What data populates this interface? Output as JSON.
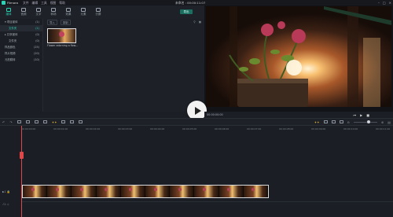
{
  "titlebar": {
    "app_name": "Filmora",
    "menu": [
      "文件",
      "编辑",
      "工具",
      "视图",
      "帮助"
    ],
    "center": "未命名 : 00:00:11:07"
  },
  "tooltabs": [
    {
      "label": "媒体",
      "active": true
    },
    {
      "label": "音频",
      "active": false
    },
    {
      "label": "文字",
      "active": false
    },
    {
      "label": "转场",
      "active": false
    },
    {
      "label": "效果",
      "active": false
    },
    {
      "label": "元素",
      "active": false
    },
    {
      "label": "分屏",
      "active": false
    }
  ],
  "export_label": "导出",
  "sidebar": {
    "items": [
      {
        "label": "▾ 项目媒体",
        "count": "(1)",
        "active": false,
        "sub": false
      },
      {
        "label": "文件夹",
        "count": "(1)",
        "active": true,
        "sub": true
      },
      {
        "label": "▸ 共享媒体",
        "count": "(0)",
        "active": false,
        "sub": false
      },
      {
        "label": "文件夹",
        "count": "(0)",
        "active": false,
        "sub": true
      },
      {
        "label": "样品颜色",
        "count": "(25)",
        "active": false,
        "sub": false
      },
      {
        "label": "样片视频",
        "count": "(20)",
        "active": false,
        "sub": false
      },
      {
        "label": "元拍跳转",
        "count": "(10)",
        "active": false,
        "sub": false
      }
    ]
  },
  "media": {
    "toolbar": [
      "导入",
      "录制"
    ],
    "clip_label": "Flower adorning a flow..."
  },
  "preview": {
    "timecode": "00:00:00:00",
    "controls": [
      "⏮",
      "▶",
      "■"
    ]
  },
  "ruler_ticks": [
    "00:00:00:00",
    "00:00:01:00",
    "00:00:02:00",
    "00:00:03:00",
    "00:00:04:00",
    "00:00:05:00",
    "00:00:06:00",
    "00:00:07:00",
    "00:00:08:00",
    "00:00:09:00",
    "00:00:10:00",
    "00:00:11:00",
    "00:00:12:00"
  ],
  "tracks": {
    "video_label": "▶1",
    "audio_label": "♪1"
  },
  "colors": {
    "accent": "#2ad3b6",
    "playhead": "#e04848",
    "export": "#1a6f61"
  }
}
